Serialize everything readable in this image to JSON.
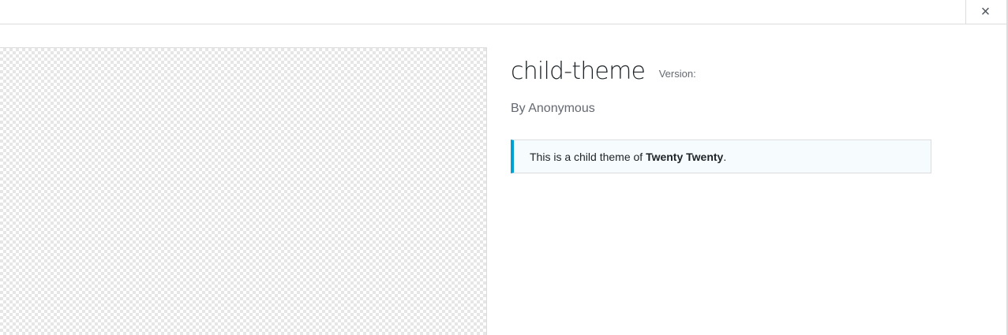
{
  "modal": {
    "close_label": "×"
  },
  "theme": {
    "name": "child-theme",
    "version_label": "Version:",
    "author": "By Anonymous"
  },
  "notice": {
    "prefix": "This is a child theme of ",
    "parent_name": "Twenty Twenty",
    "suffix": "."
  },
  "colors": {
    "notice_accent": "#00a0d2",
    "notice_background": "#f6fbfd",
    "border": "#dcdcde"
  }
}
